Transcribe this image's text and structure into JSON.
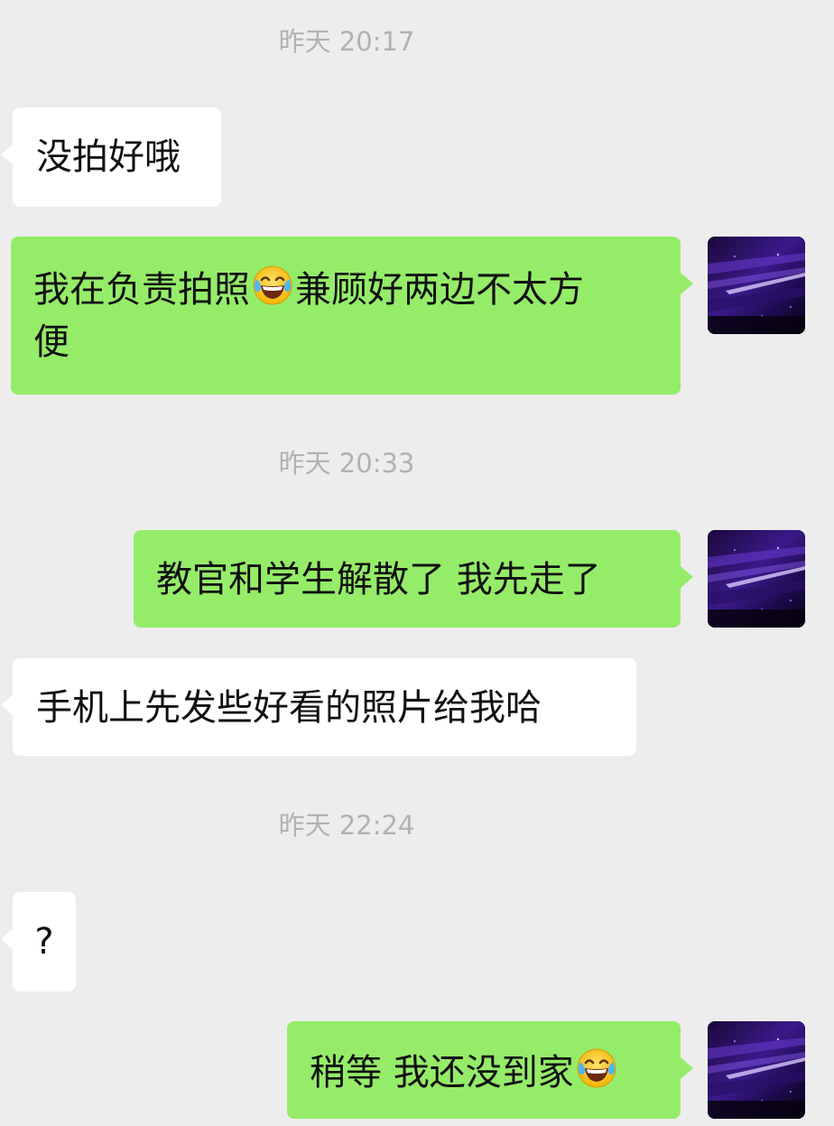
{
  "conversation": {
    "timestamps": {
      "t1": "昨天 20:17",
      "t2": "昨天 20:33",
      "t3": "昨天 22:24"
    },
    "messages": {
      "m1": "没拍好哦",
      "m2": {
        "before_emoji": "我在负责拍照",
        "after_emoji": "兼顾好两边不太方",
        "line2": "便"
      },
      "m3": "教官和学生解散了 我先走了",
      "m4": "手机上先发些好看的照片给我哈",
      "m5": "?",
      "m6": {
        "text": "稍等 我还没到家"
      }
    },
    "emoji_name": "tears-of-joy-emoji",
    "avatar_name": "purple-night-sky-avatar"
  },
  "colors": {
    "background": "#ededed",
    "incoming_bubble": "#ffffff",
    "outgoing_bubble": "#95ec69",
    "timestamp_text": "#b2b2b2",
    "message_text": "#111111"
  }
}
